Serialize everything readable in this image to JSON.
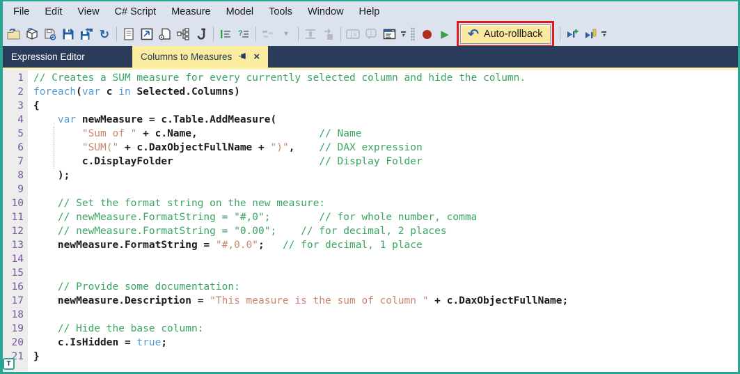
{
  "menu": {
    "items": [
      "File",
      "Edit",
      "View",
      "C# Script",
      "Measure",
      "Model",
      "Tools",
      "Window",
      "Help"
    ]
  },
  "toolbar": {
    "auto_rollback": {
      "label": "Auto-rollback"
    },
    "icon_names": [
      "open-folder-icon",
      "open-model-icon",
      "deploy-save-icon",
      "save-icon",
      "save-as-icon",
      "refresh-icon",
      "new-script-icon",
      "edit-window-icon",
      "script-file-icon",
      "model-tree-icon",
      "csharp-script-icon",
      "format-dax-icon",
      "comment-lines-icon",
      "perspective-blocks-icon",
      "perspective-dropdown-icon",
      "expand-column-icon",
      "goto-object-icon",
      "dax-box-icon",
      "warning-bubble-icon",
      "form-view-icon",
      "record-macro-icon",
      "run-script-icon",
      "undo-icon",
      "apply-step-add-icon",
      "apply-step-highlight-icon"
    ],
    "glyphs": {
      "refresh": "↻",
      "undo": "↶",
      "dropdown": "▾",
      "play": "▶",
      "question": "?"
    }
  },
  "tabs": {
    "panel_title": "Expression Editor",
    "document_tab": {
      "label": "Columns to Measures",
      "close_glyph": "×"
    }
  },
  "editor": {
    "badge": "T",
    "line_count": 21,
    "lines": [
      [
        [
          "c",
          "// Creates a SUM measure for every currently selected column and hide the column."
        ]
      ],
      [
        [
          "k",
          "foreach"
        ],
        [
          "d",
          "("
        ],
        [
          "k",
          "var"
        ],
        [
          "d",
          " c "
        ],
        [
          "k",
          "in"
        ],
        [
          "d",
          " Selected.Columns)"
        ]
      ],
      [
        [
          "d",
          "{"
        ]
      ],
      [
        [
          "d",
          "    "
        ],
        [
          "k",
          "var"
        ],
        [
          "d",
          " newMeasure = c.Table.AddMeasure("
        ]
      ],
      [
        [
          "d",
          "        "
        ],
        [
          "s",
          "\"Sum of \""
        ],
        [
          "d",
          " + c.Name,"
        ],
        [
          "d",
          "                    "
        ],
        [
          "c",
          "// Name"
        ]
      ],
      [
        [
          "d",
          "        "
        ],
        [
          "s",
          "\"SUM(\""
        ],
        [
          "d",
          " + c.DaxObjectFullName + "
        ],
        [
          "s",
          "\")\""
        ],
        [
          "d",
          ",    "
        ],
        [
          "c",
          "// DAX expression"
        ]
      ],
      [
        [
          "d",
          "        c.DisplayFolder"
        ],
        [
          "d",
          "                        "
        ],
        [
          "c",
          "// Display Folder"
        ]
      ],
      [
        [
          "d",
          "    );"
        ]
      ],
      [],
      [
        [
          "d",
          "    "
        ],
        [
          "c",
          "// Set the format string on the new measure:"
        ]
      ],
      [
        [
          "d",
          "    "
        ],
        [
          "c",
          "// newMeasure.FormatString = \"#,0\";        // for whole number, comma"
        ]
      ],
      [
        [
          "d",
          "    "
        ],
        [
          "c",
          "// newMeasure.FormatString = \"0.00\";    // for decimal, 2 places"
        ]
      ],
      [
        [
          "d",
          "    newMeasure.FormatString = "
        ],
        [
          "s",
          "\"#,0.0\""
        ],
        [
          "d",
          ";   "
        ],
        [
          "c",
          "// for decimal, 1 place"
        ]
      ],
      [],
      [],
      [
        [
          "d",
          "    "
        ],
        [
          "c",
          "// Provide some documentation:"
        ]
      ],
      [
        [
          "d",
          "    newMeasure.Description = "
        ],
        [
          "s",
          "\"This measure is the sum of column \""
        ],
        [
          "d",
          " + c.DaxObjectFullName;"
        ]
      ],
      [],
      [
        [
          "d",
          "    "
        ],
        [
          "c",
          "// Hide the base column:"
        ]
      ],
      [
        [
          "d",
          "    c.IsHidden = "
        ],
        [
          "k",
          "true"
        ],
        [
          "d",
          ";"
        ]
      ],
      [
        [
          "d",
          "}"
        ]
      ]
    ]
  },
  "colors": {
    "frame_border": "#2aa493",
    "menubar_bg": "#dce2ee",
    "tabstrip_bg": "#2a3c59",
    "active_tab_bg": "#fcec9f",
    "tab_underline": "#fdf3b3",
    "annotation_highlight": "#e01a14",
    "rollback_button_bg": "#fce9a0",
    "comment_green": "#3aa561",
    "keyword_blue": "#569cd6",
    "string_salmon": "#c9876f",
    "line_number_purple": "#75569c",
    "record_red": "#ad2d1e",
    "play_green": "#3a9e4a"
  }
}
